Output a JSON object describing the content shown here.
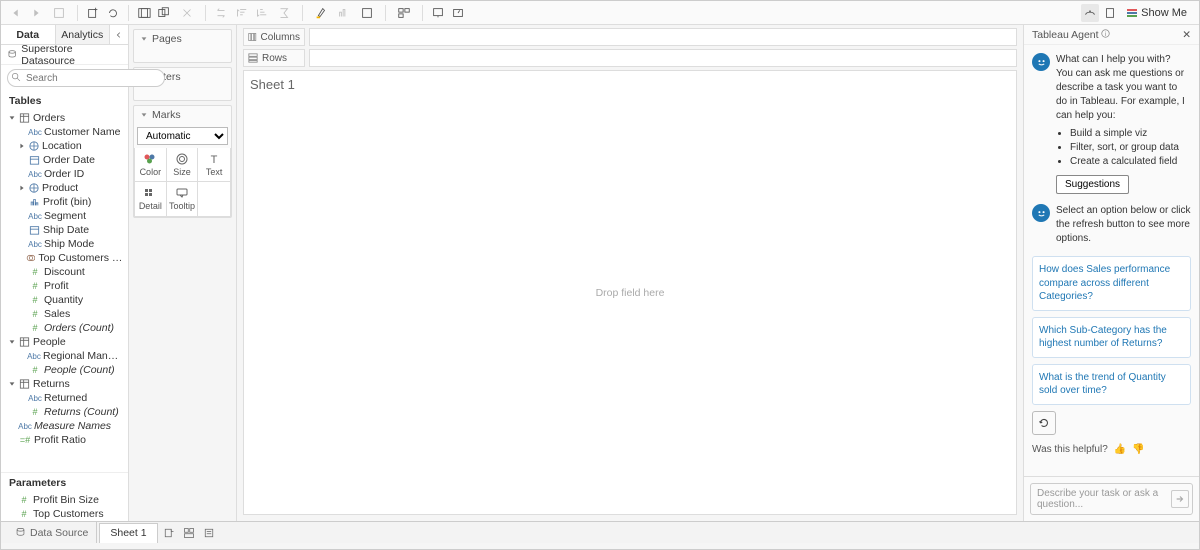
{
  "toolbar": {
    "show_me": "Show Me"
  },
  "data_panel": {
    "tab_data": "Data",
    "tab_analytics": "Analytics",
    "datasource": "Superstore Datasource",
    "search_placeholder": "Search",
    "tables_label": "Tables",
    "params_label": "Parameters",
    "tables": [
      {
        "label": "Orders",
        "type": "table",
        "level": 0,
        "expand": true
      },
      {
        "label": "Customer Name",
        "type": "abc",
        "level": 1
      },
      {
        "label": "Location",
        "type": "geo",
        "level": 1,
        "chevron": true
      },
      {
        "label": "Order Date",
        "type": "date",
        "level": 1
      },
      {
        "label": "Order ID",
        "type": "abc",
        "level": 1
      },
      {
        "label": "Product",
        "type": "geo",
        "level": 1,
        "chevron": true
      },
      {
        "label": "Profit (bin)",
        "type": "bin",
        "level": 1
      },
      {
        "label": "Segment",
        "type": "abc",
        "level": 1
      },
      {
        "label": "Ship Date",
        "type": "date",
        "level": 1
      },
      {
        "label": "Ship Mode",
        "type": "abc",
        "level": 1
      },
      {
        "label": "Top Customers by P...",
        "type": "set",
        "level": 1
      },
      {
        "label": "Discount",
        "type": "num",
        "level": 1
      },
      {
        "label": "Profit",
        "type": "num",
        "level": 1
      },
      {
        "label": "Quantity",
        "type": "num",
        "level": 1
      },
      {
        "label": "Sales",
        "type": "num",
        "level": 1
      },
      {
        "label": "Orders (Count)",
        "type": "num",
        "level": 1,
        "italic": true
      },
      {
        "label": "People",
        "type": "table",
        "level": 0,
        "expand": true
      },
      {
        "label": "Regional Manager",
        "type": "abc",
        "level": 1
      },
      {
        "label": "People (Count)",
        "type": "num",
        "level": 1,
        "italic": true
      },
      {
        "label": "Returns",
        "type": "table",
        "level": 0,
        "expand": true
      },
      {
        "label": "Returned",
        "type": "abc",
        "level": 1
      },
      {
        "label": "Returns (Count)",
        "type": "num",
        "level": 1,
        "italic": true
      },
      {
        "label": "Measure Names",
        "type": "abc",
        "level": 0,
        "italic": true
      },
      {
        "label": "Profit Ratio",
        "type": "calc",
        "level": 0
      }
    ],
    "params": [
      {
        "label": "Profit Bin Size",
        "type": "num"
      },
      {
        "label": "Top Customers",
        "type": "num"
      }
    ]
  },
  "shelves": {
    "pages": "Pages",
    "filters": "Filters",
    "marks": "Marks",
    "mark_type": "Automatic",
    "cells": [
      {
        "label": "Color",
        "name": "color"
      },
      {
        "label": "Size",
        "name": "size"
      },
      {
        "label": "Text",
        "name": "text"
      },
      {
        "label": "Detail",
        "name": "detail"
      },
      {
        "label": "Tooltip",
        "name": "tooltip"
      }
    ]
  },
  "worksheet": {
    "columns": "Columns",
    "rows": "Rows",
    "sheet_title": "Sheet 1",
    "drop_hint": "Drop field here"
  },
  "agent": {
    "title": "Tableau Agent",
    "greeting": "What can I help you with?",
    "intro": "You can ask me questions or describe a task you want to do in Tableau. For example, I can help you:",
    "bullets": [
      "Build a simple viz",
      "Filter, sort, or group data",
      "Create a calculated field"
    ],
    "suggestions_btn": "Suggestions",
    "select_prompt": "Select an option below or click the refresh button to see more options.",
    "questions": [
      "How does Sales performance compare across different Categories?",
      "Which Sub-Category has the highest number of Returns?",
      "What is the trend of Quantity sold over time?"
    ],
    "helpful": "Was this helpful?",
    "input_placeholder": "Describe your task or ask a question..."
  },
  "bottom": {
    "data_source": "Data Source",
    "sheet": "Sheet 1"
  }
}
